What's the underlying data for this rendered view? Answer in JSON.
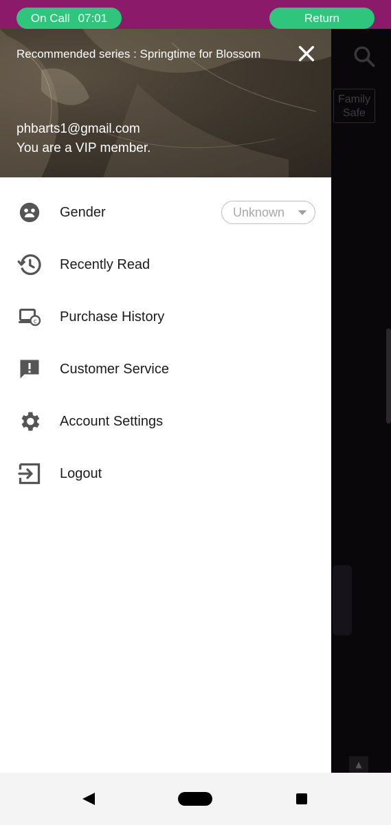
{
  "callbar": {
    "call_label": "On Call",
    "call_time": "07:01",
    "return_label": "Return",
    "bg_color": "#8b1a6b",
    "pill_color": "#2fc57d"
  },
  "background_app": {
    "search_icon": "search-icon",
    "family_safe_line1": "Family",
    "family_safe_line2": "Safe"
  },
  "drawer": {
    "recommended_text": "Recommended series : Springtime for Blossom",
    "close_icon": "close-icon",
    "email": "phbarts1@gmail.com",
    "membership": "You are a VIP member.",
    "menu": [
      {
        "label": "Gender",
        "icon": "gender-face-icon"
      },
      {
        "label": "Recently Read",
        "icon": "history-icon"
      },
      {
        "label": "Purchase History",
        "icon": "purchase-history-icon"
      },
      {
        "label": "Customer Service",
        "icon": "feedback-icon"
      },
      {
        "label": "Account Settings",
        "icon": "gear-icon"
      },
      {
        "label": "Logout",
        "icon": "logout-icon"
      }
    ],
    "gender_value": "Unknown"
  },
  "navbar": {
    "back_icon": "back-triangle-icon",
    "home_icon": "home-pill-icon",
    "recents_icon": "recents-square-icon"
  }
}
